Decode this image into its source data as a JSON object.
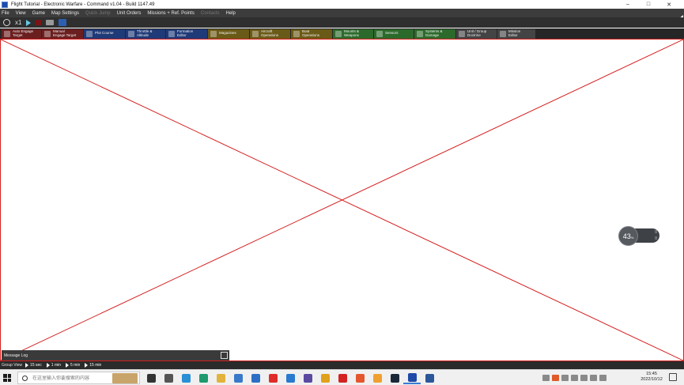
{
  "window": {
    "title": "Flight Tutorial - Electronic Warfare - Command v1.04 - Build 1147.49",
    "controls": [
      "–",
      "□",
      "✕"
    ]
  },
  "menu": {
    "items": [
      {
        "label": "File",
        "enabled": true
      },
      {
        "label": "View",
        "enabled": true
      },
      {
        "label": "Game",
        "enabled": true
      },
      {
        "label": "Map Settings",
        "enabled": true
      },
      {
        "label": "Quick Jump",
        "enabled": false
      },
      {
        "label": "Unit Orders",
        "enabled": true
      },
      {
        "label": "Missions + Ref. Points",
        "enabled": true
      },
      {
        "label": "Contacts",
        "enabled": false
      },
      {
        "label": "Help",
        "enabled": true
      }
    ]
  },
  "controls": {
    "speed": "x1"
  },
  "toolbar": {
    "buttons": [
      {
        "label": "Auto Engage\nTarget",
        "color": "#6b1f1f",
        "icon": "crosshair-icon"
      },
      {
        "label": "Manual\nEngage Target",
        "color": "#6b1f1f",
        "icon": "crosshair-icon"
      },
      {
        "label": "Plot Course",
        "color": "#1f3a78",
        "icon": "course-icon"
      },
      {
        "label": "Throttle &\nAltitude",
        "color": "#1f3a78",
        "icon": "throttle-icon"
      },
      {
        "label": "Formation\nEditor",
        "color": "#1f3a78",
        "icon": "formation-icon"
      },
      {
        "label": "Magazines",
        "color": "#6a5a17",
        "icon": "magazine-icon"
      },
      {
        "label": "Aircraft\nOperations",
        "color": "#6a5a17",
        "icon": "aircraft-icon"
      },
      {
        "label": "Boat\nOperations",
        "color": "#6a5a17",
        "icon": "boat-icon"
      },
      {
        "label": "Mounts &\nWeapons",
        "color": "#2c6a2c",
        "icon": "weapons-icon"
      },
      {
        "label": "Sensors",
        "color": "#2c6a2c",
        "icon": "sensor-icon"
      },
      {
        "label": "Systems &\nDamage",
        "color": "#2c6a2c",
        "icon": "gear-icon"
      },
      {
        "label": "Unit / Group\nDoctrine",
        "color": "#444444",
        "icon": "doctrine-icon"
      },
      {
        "label": "Mission\nEditor",
        "color": "#444444",
        "icon": "mission-icon"
      }
    ]
  },
  "map": {
    "border_color": "#d41e1e"
  },
  "message_log": {
    "label": "Message Log"
  },
  "zoom_widget": {
    "value": "43",
    "unit": "%",
    "readout_top": "0",
    "readout_bottom": "0"
  },
  "group_view": {
    "label": "Group View",
    "steps": [
      "15 sec",
      "1 min",
      "5 min",
      "15 min"
    ]
  },
  "taskbar": {
    "search_placeholder": "在这里输入你要搜索的内容",
    "apps": [
      {
        "name": "cortana-icon",
        "color": "#333333"
      },
      {
        "name": "task-view-icon",
        "color": "#555555"
      },
      {
        "name": "edge-icon",
        "color": "#2b8fd6"
      },
      {
        "name": "edge-chromium-icon",
        "color": "#1f9a6f"
      },
      {
        "name": "file-explorer-icon",
        "color": "#e2b33c"
      },
      {
        "name": "store-icon",
        "color": "#3a79c9"
      },
      {
        "name": "mail-icon",
        "color": "#2d6fc4"
      },
      {
        "name": "app-red-icon",
        "color": "#e02b2b"
      },
      {
        "name": "vs-code-icon",
        "color": "#2a7ad0"
      },
      {
        "name": "vcc-icon",
        "color": "#5b4aa0"
      },
      {
        "name": "chrome-icon",
        "color": "#e0a21b"
      },
      {
        "name": "netease-icon",
        "color": "#d42222"
      },
      {
        "name": "office-icon",
        "color": "#e4572e"
      },
      {
        "name": "app-orange-icon",
        "color": "#f0a030"
      },
      {
        "name": "steam-icon",
        "color": "#1b2838"
      },
      {
        "name": "command-game-icon",
        "color": "#1f4aa8",
        "active": true
      },
      {
        "name": "word-icon",
        "color": "#2b579a"
      }
    ],
    "time": "15:45",
    "date": "2022/10/12"
  }
}
